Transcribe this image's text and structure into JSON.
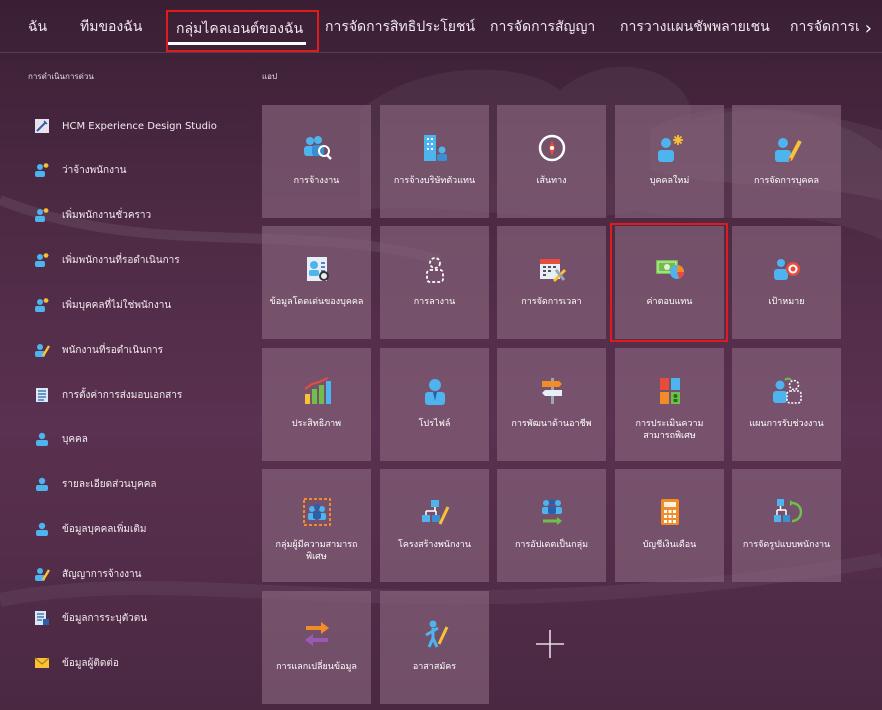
{
  "nav": {
    "tabs": [
      "ฉัน",
      "ทีมของฉัน",
      "กลุ่มไคลเอนต์ของฉัน",
      "การจัดการสิทธิประโยชน์",
      "การจัดการสัญญา",
      "การวางแผนชัพพลายเชน",
      "การจัดการเ"
    ],
    "active_index": 2,
    "next_arrow": "›"
  },
  "quick_actions": {
    "title": "การดำเนินการด่วน",
    "items": [
      {
        "label": "HCM Experience Design Studio",
        "icon": "design-studio-icon"
      },
      {
        "label": "ว่าจ้างพนักงาน",
        "icon": "person-add-icon"
      },
      {
        "label": "เพิ่มพนักงานชั่วคราว",
        "icon": "person-add-icon"
      },
      {
        "label": "เพิ่มพนักงานที่รอดำเนินการ",
        "icon": "person-add-icon"
      },
      {
        "label": "เพิ่มบุคคลที่ไม่ใช่พนักงาน",
        "icon": "person-add-icon"
      },
      {
        "label": "พนักงานที่รอดำเนินการ",
        "icon": "person-edit-icon"
      },
      {
        "label": "การตั้งค่าการส่งมอบเอกสาร",
        "icon": "document-icon"
      },
      {
        "label": "บุคคล",
        "icon": "person-icon"
      },
      {
        "label": "รายละเอียดส่วนบุคคล",
        "icon": "person-icon"
      },
      {
        "label": "ข้อมูลบุคคลเพิ่มเติม",
        "icon": "person-icon"
      },
      {
        "label": "สัญญาการจ้างงาน",
        "icon": "person-edit-icon"
      },
      {
        "label": "ข้อมูลการระบุตัวตน",
        "icon": "id-document-icon"
      },
      {
        "label": "ข้อมูลผู้ติดต่อ",
        "icon": "envelope-icon"
      }
    ]
  },
  "apps": {
    "title": "แอป",
    "tiles": [
      {
        "label": "การจ้างงาน",
        "icon": "hiring-icon"
      },
      {
        "label": "การจ้างบริษัทตัวแทน",
        "icon": "agency-icon"
      },
      {
        "label": "เส้นทาง",
        "icon": "compass-icon"
      },
      {
        "label": "บุคคลใหม่",
        "icon": "new-person-icon"
      },
      {
        "label": "การจัดการบุคคล",
        "icon": "person-manage-icon"
      },
      {
        "label": "ข้อมูลโดดเด่นของบุคคล",
        "icon": "person-spotlight-icon"
      },
      {
        "label": "การลางาน",
        "icon": "absence-icon"
      },
      {
        "label": "การจัดการเวลา",
        "icon": "calendar-tools-icon"
      },
      {
        "label": "ค่าตอบแทน",
        "icon": "compensation-icon"
      },
      {
        "label": "เป้าหมาย",
        "icon": "goal-target-icon"
      },
      {
        "label": "ประสิทธิภาพ",
        "icon": "performance-chart-icon"
      },
      {
        "label": "โปรไฟล์",
        "icon": "profile-icon"
      },
      {
        "label": "การพัฒนาด้านอาชีพ",
        "icon": "career-signpost-icon"
      },
      {
        "label": "การประเมินความสามารถพิเศษ",
        "icon": "talent-review-icon"
      },
      {
        "label": "แผนการรับช่วงงาน",
        "icon": "succession-icon"
      },
      {
        "label": "กลุ่มผู้มีความสามารถพิเศษ",
        "icon": "talent-pool-icon"
      },
      {
        "label": "โครงสร้างพนักงาน",
        "icon": "org-structure-icon"
      },
      {
        "label": "การอัปเดตเป็นกลุ่ม",
        "icon": "mass-update-icon"
      },
      {
        "label": "บัญชีเงินเดือน",
        "icon": "calculator-icon"
      },
      {
        "label": "การจัดรูปแบบพนักงาน",
        "icon": "workforce-modeling-icon"
      },
      {
        "label": "การแลกเปลี่ยนข้อมูล",
        "icon": "data-exchange-icon"
      },
      {
        "label": "อาสาสมัคร",
        "icon": "volunteer-icon"
      }
    ],
    "add_icon": "plus-icon"
  },
  "colors": {
    "highlight": "#e01b1b",
    "accent_blue": "#3fa9f5",
    "accent_orange": "#f28c28"
  }
}
